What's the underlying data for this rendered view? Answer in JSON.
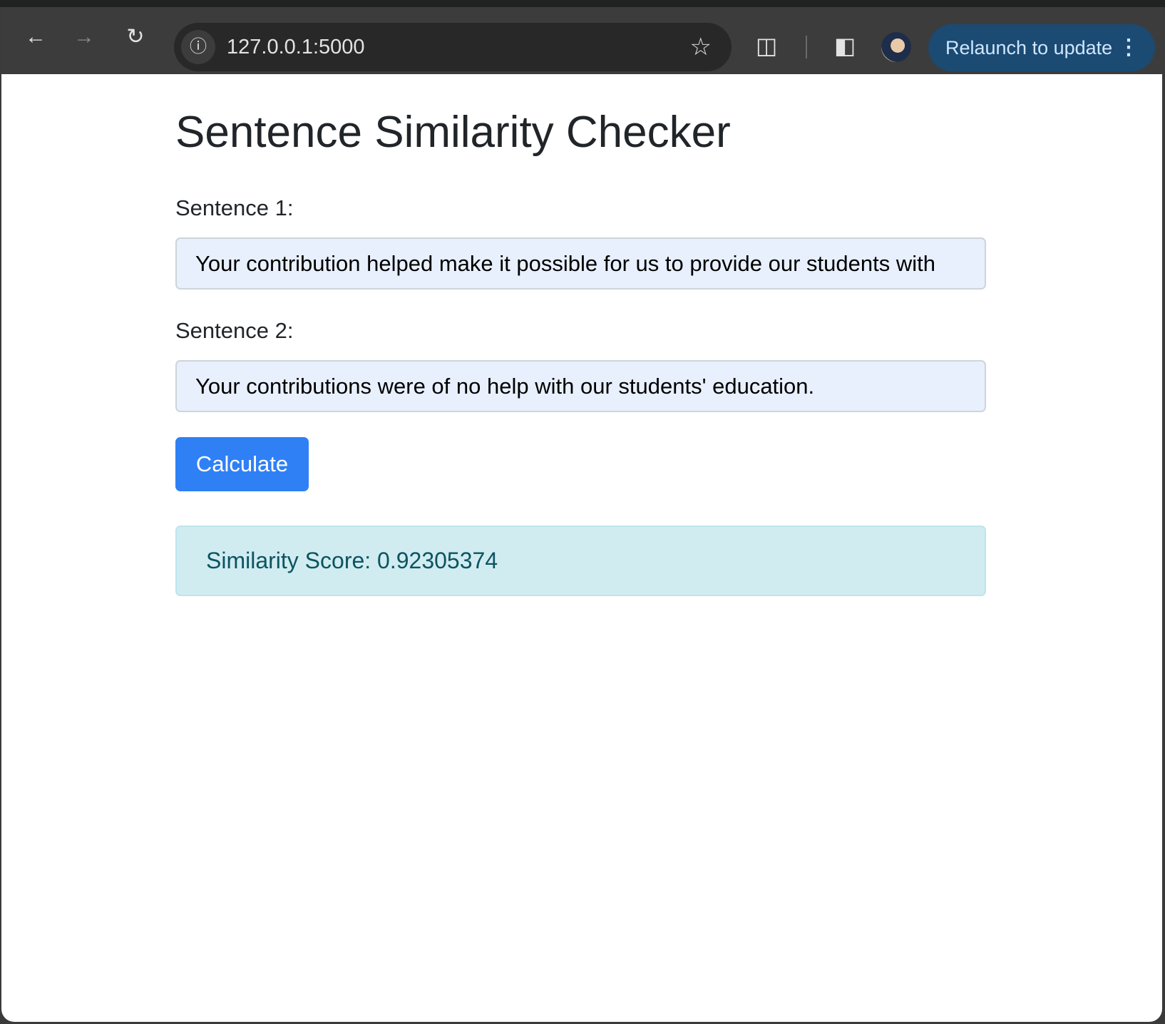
{
  "browser": {
    "url": "127.0.0.1:5000",
    "relaunch_label": "Relaunch to update",
    "icons": [
      "back-icon",
      "forward-icon",
      "reload-icon",
      "site-info-icon",
      "bookmark-star-icon",
      "extensions-icon",
      "side-panel-icon",
      "profile-avatar",
      "menu-kebab-icon"
    ]
  },
  "page": {
    "title": "Sentence Similarity Checker",
    "sentence1_label": "Sentence 1:",
    "sentence1_value": "Your contribution helped make it possible for us to provide our students with",
    "sentence2_label": "Sentence 2:",
    "sentence2_value": "Your contributions were of no help with our students' education.",
    "calculate_label": "Calculate",
    "result": "Similarity Score: 0.92305374"
  },
  "colors": {
    "button": "#2f80f5",
    "alert_bg": "#d1ecf1",
    "relaunch_bg": "#1b4a72"
  }
}
